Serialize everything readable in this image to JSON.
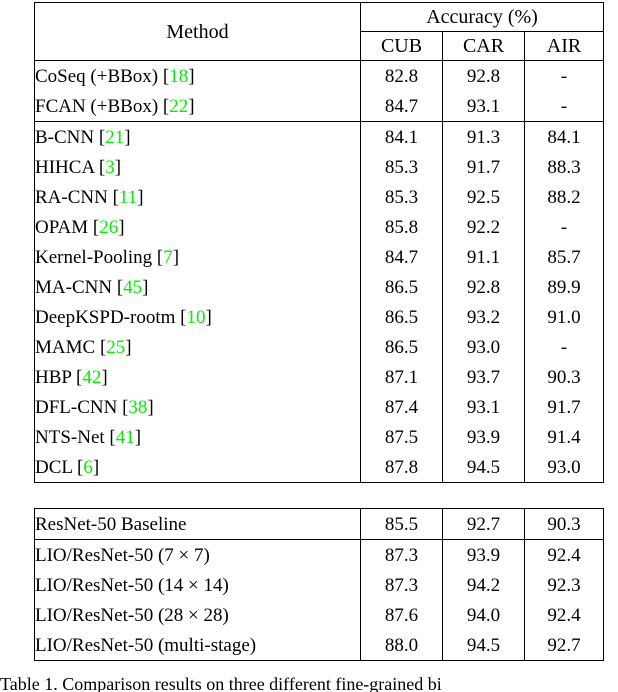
{
  "figure": {
    "caption": "Table 1. Comparison results on three different fine-grained bi",
    "citation_color": "#00ee00"
  },
  "table": {
    "header": {
      "method_label": "Method",
      "accuracy_label": "Accuracy (%)",
      "columns": [
        "CUB",
        "CAR",
        "AIR"
      ]
    },
    "groups": [
      {
        "name": "bbox-methods",
        "rows": [
          {
            "method": "CoSeq (+BBox)",
            "cite": "18",
            "cub": "82.8",
            "car": "92.8",
            "air": "-",
            "bold": {
              "cub": false,
              "car": false,
              "air": false
            }
          },
          {
            "method": "FCAN (+BBox)",
            "cite": "22",
            "cub": "84.7",
            "car": "93.1",
            "air": "-",
            "bold": {
              "cub": false,
              "car": false,
              "air": false
            }
          }
        ]
      },
      {
        "name": "sota-methods",
        "rows": [
          {
            "method": "B-CNN",
            "cite": "21",
            "cub": "84.1",
            "car": "91.3",
            "air": "84.1",
            "bold": {
              "cub": false,
              "car": false,
              "air": false
            }
          },
          {
            "method": "HIHCA",
            "cite": "3",
            "cub": "85.3",
            "car": "91.7",
            "air": "88.3",
            "bold": {
              "cub": false,
              "car": false,
              "air": false
            }
          },
          {
            "method": "RA-CNN",
            "cite": "11",
            "cub": "85.3",
            "car": "92.5",
            "air": "88.2",
            "bold": {
              "cub": false,
              "car": false,
              "air": false
            }
          },
          {
            "method": "OPAM",
            "cite": "26",
            "cub": "85.8",
            "car": "92.2",
            "air": "-",
            "bold": {
              "cub": false,
              "car": false,
              "air": false
            }
          },
          {
            "method": "Kernel-Pooling",
            "cite": "7",
            "cub": "84.7",
            "car": "91.1",
            "air": "85.7",
            "bold": {
              "cub": false,
              "car": false,
              "air": false
            }
          },
          {
            "method": "MA-CNN",
            "cite": "45",
            "cub": "86.5",
            "car": "92.8",
            "air": "89.9",
            "bold": {
              "cub": false,
              "car": false,
              "air": false
            }
          },
          {
            "method": "DeepKSPD-rootm",
            "cite": "10",
            "cub": "86.5",
            "car": "93.2",
            "air": "91.0",
            "bold": {
              "cub": false,
              "car": false,
              "air": false
            }
          },
          {
            "method": "MAMC",
            "cite": "25",
            "cub": "86.5",
            "car": "93.0",
            "air": "-",
            "bold": {
              "cub": false,
              "car": false,
              "air": false
            }
          },
          {
            "method": "HBP",
            "cite": "42",
            "cub": "87.1",
            "car": "93.7",
            "air": "90.3",
            "bold": {
              "cub": false,
              "car": false,
              "air": false
            }
          },
          {
            "method": "DFL-CNN",
            "cite": "38",
            "cub": "87.4",
            "car": "93.1",
            "air": "91.7",
            "bold": {
              "cub": false,
              "car": false,
              "air": false
            }
          },
          {
            "method": "NTS-Net",
            "cite": "41",
            "cub": "87.5",
            "car": "93.9",
            "air": "91.4",
            "bold": {
              "cub": false,
              "car": false,
              "air": false
            }
          },
          {
            "method": "DCL",
            "cite": "6",
            "cub": "87.8",
            "car": "94.5",
            "air": "93.0",
            "bold": {
              "cub": false,
              "car": true,
              "air": true
            }
          }
        ]
      },
      {
        "name": "baseline",
        "rows": [
          {
            "method": "ResNet-50 Baseline",
            "cite": "",
            "cub": "85.5",
            "car": "92.7",
            "air": "90.3",
            "bold": {
              "cub": false,
              "car": false,
              "air": false
            }
          }
        ]
      },
      {
        "name": "lio-variants",
        "rows": [
          {
            "method": "LIO/ResNet-50 (7 × 7)",
            "cite": "",
            "cub": "87.3",
            "car": "93.9",
            "air": "92.4",
            "bold": {
              "cub": false,
              "car": false,
              "air": false
            }
          },
          {
            "method": "LIO/ResNet-50 (14 × 14)",
            "cite": "",
            "cub": "87.3",
            "car": "94.2",
            "air": "92.3",
            "bold": {
              "cub": false,
              "car": false,
              "air": false
            }
          },
          {
            "method": "LIO/ResNet-50 (28 × 28)",
            "cite": "",
            "cub": "87.6",
            "car": "94.0",
            "air": "92.4",
            "bold": {
              "cub": false,
              "car": false,
              "air": false
            }
          },
          {
            "method": "LIO/ResNet-50 (multi-stage)",
            "cite": "",
            "cub": "88.0",
            "car": "94.5",
            "air": "92.7",
            "bold": {
              "cub": true,
              "car": true,
              "air": false
            }
          }
        ]
      }
    ]
  }
}
